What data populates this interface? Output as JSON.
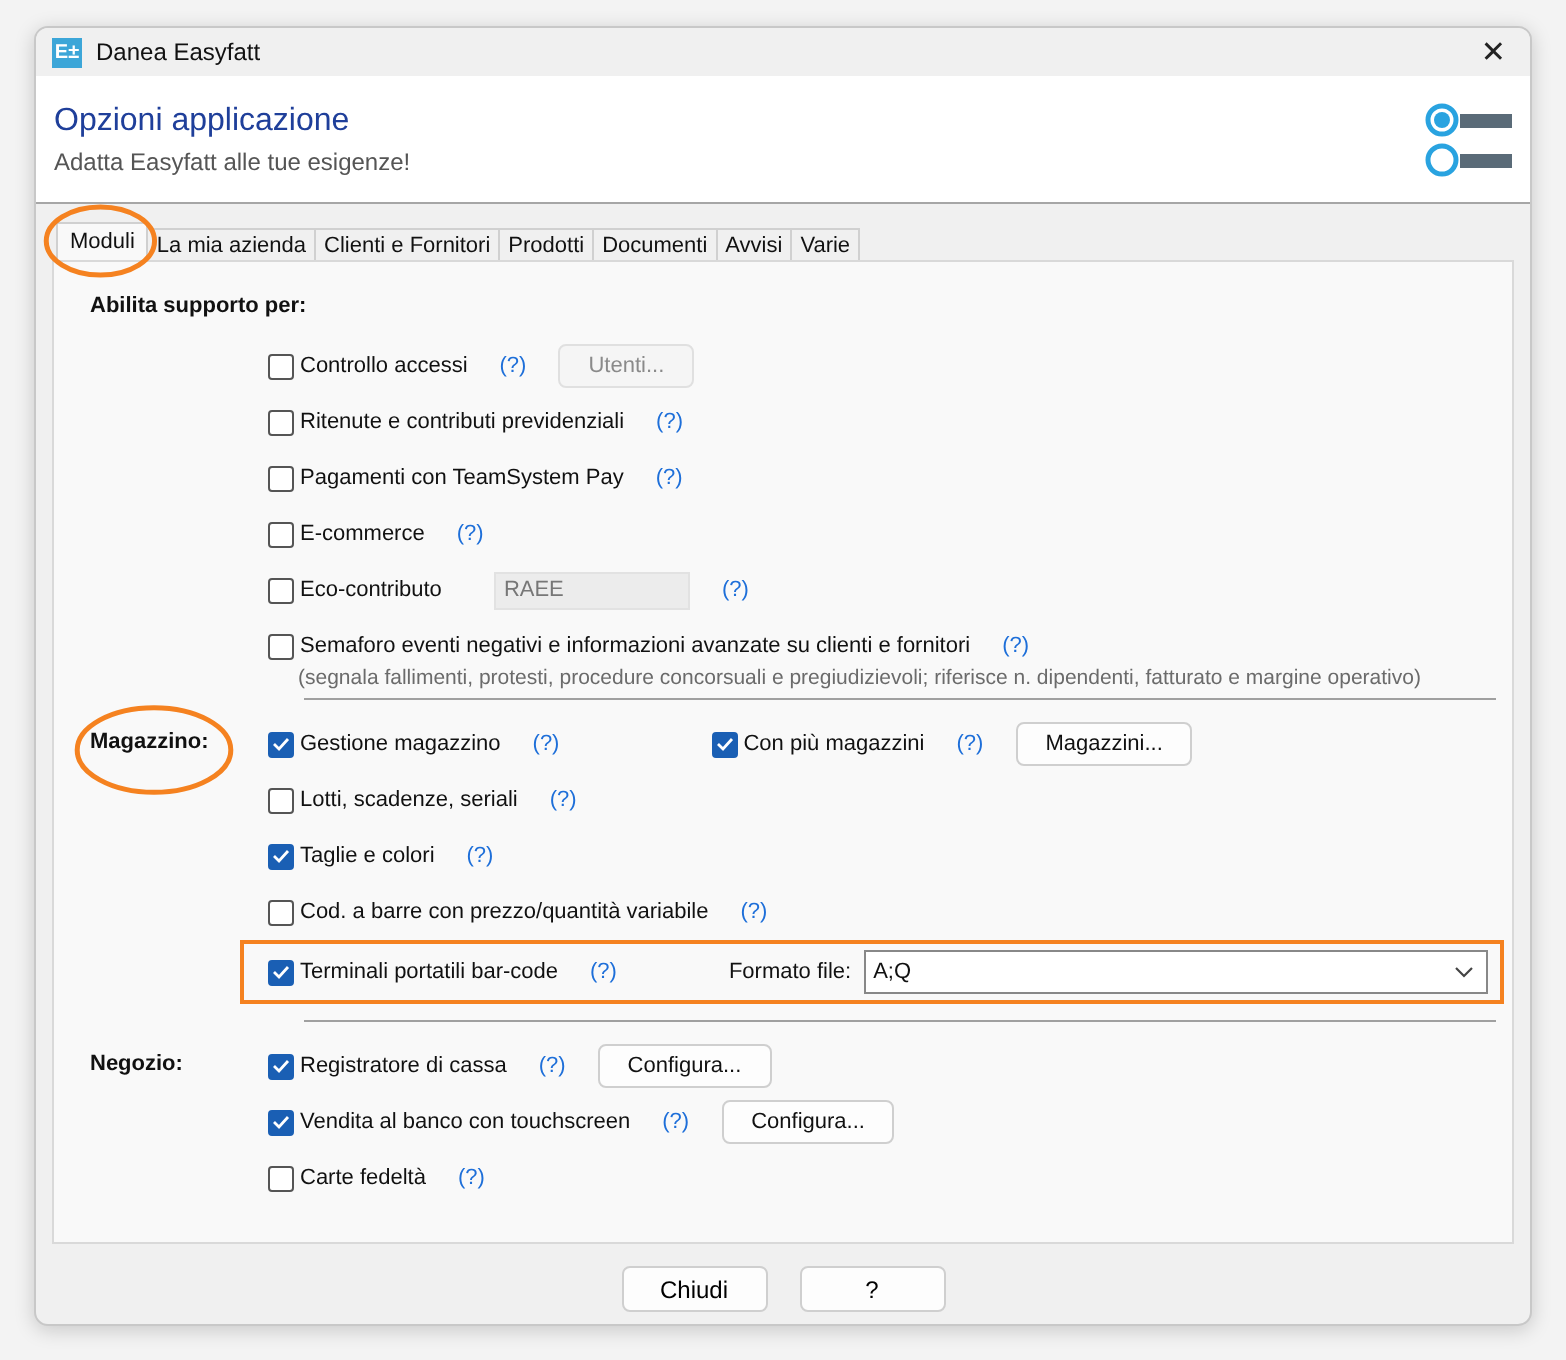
{
  "window": {
    "title": "Danea Easyfatt",
    "app_icon": "E±",
    "close": "✕"
  },
  "header": {
    "title": "Opzioni applicazione",
    "subtitle": "Adatta Easyfatt alle tue esigenze!"
  },
  "tabs": [
    {
      "label": "Moduli",
      "selected": true,
      "circled": true
    },
    {
      "label": "La mia azienda",
      "selected": false,
      "circled": false
    },
    {
      "label": "Clienti e Fornitori",
      "selected": false,
      "circled": false
    },
    {
      "label": "Prodotti",
      "selected": false,
      "circled": false
    },
    {
      "label": "Documenti",
      "selected": false,
      "circled": false
    },
    {
      "label": "Avvisi",
      "selected": false,
      "circled": false
    },
    {
      "label": "Varie",
      "selected": false,
      "circled": false
    }
  ],
  "sections": [
    {
      "label": "Abilita supporto per:",
      "kind": "heading",
      "circled": false,
      "rows": [
        {
          "label": "Controllo accessi",
          "checked": false,
          "highlighted": false,
          "help": "(?)",
          "button": {
            "label": "Utenti...",
            "disabled": true
          }
        },
        {
          "label": "Ritenute e contributi previdenziali",
          "checked": false,
          "highlighted": false,
          "help": "(?)"
        },
        {
          "label": "Pagamenti con TeamSystem Pay",
          "checked": false,
          "highlighted": false,
          "help": "(?)"
        },
        {
          "label": "E-commerce",
          "checked": false,
          "highlighted": false,
          "help": "(?)"
        },
        {
          "label": "Eco-contributo",
          "checked": false,
          "highlighted": false,
          "field": {
            "value": "RAEE",
            "disabled": true
          },
          "help": "(?)"
        },
        {
          "label": "Semaforo eventi negativi e informazioni avanzate su clienti e fornitori",
          "checked": false,
          "highlighted": false,
          "help": "(?)",
          "note": "(segnala fallimenti, protesti, procedure concorsuali e pregiudizievoli;  riferisce n. dipendenti, fatturato e margine operativo)"
        }
      ]
    },
    {
      "label": "Magazzino:",
      "kind": "inline",
      "circled": true,
      "rows": [
        {
          "label": "Gestione magazzino",
          "checked": true,
          "highlighted": false,
          "help": "(?)",
          "second": {
            "label": "Con più magazzini",
            "checked": true,
            "help": "(?)"
          },
          "button": {
            "label": "Magazzini...",
            "disabled": false
          }
        },
        {
          "label": "Lotti, scadenze, seriali",
          "checked": false,
          "highlighted": false,
          "help": "(?)"
        },
        {
          "label": "Taglie e colori",
          "checked": true,
          "highlighted": false,
          "help": "(?)"
        },
        {
          "label": "Cod. a barre con prezzo/quantità variabile",
          "checked": false,
          "highlighted": false,
          "help": "(?)"
        },
        {
          "label": "Terminali portatili bar-code",
          "checked": true,
          "help": "(?)",
          "highlighted": true,
          "select": {
            "label": "Formato file:",
            "value": "A;Q"
          }
        }
      ]
    },
    {
      "label": "Negozio:",
      "kind": "inline",
      "circled": false,
      "rows": [
        {
          "label": "Registratore di cassa",
          "checked": true,
          "highlighted": false,
          "help": "(?)",
          "button": {
            "label": "Configura...",
            "disabled": false
          }
        },
        {
          "label": "Vendita al banco con touchscreen",
          "checked": true,
          "highlighted": false,
          "help": "(?)",
          "button": {
            "label": "Configura...",
            "disabled": false
          }
        },
        {
          "label": "Carte fedeltà",
          "checked": false,
          "highlighted": false,
          "help": "(?)"
        }
      ]
    }
  ],
  "buttons": [
    "Chiudi",
    "?"
  ]
}
